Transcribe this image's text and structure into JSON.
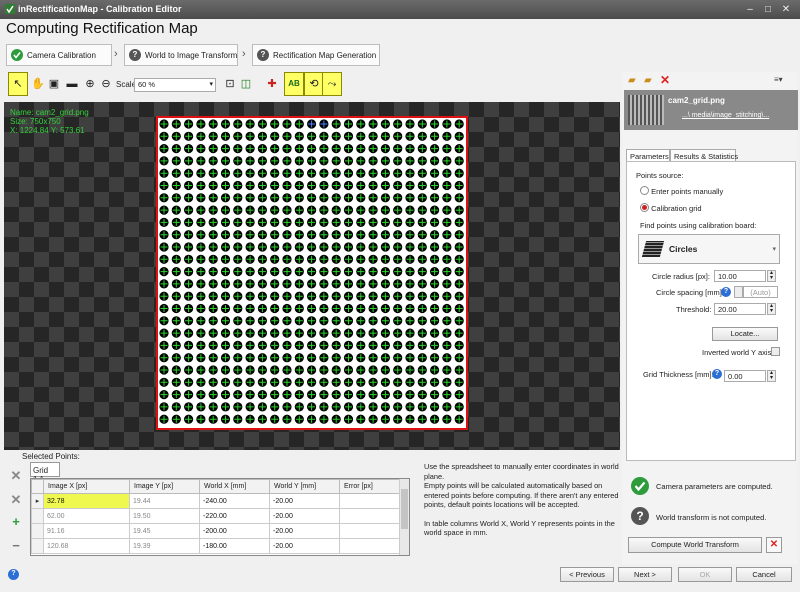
{
  "window": {
    "title": "inRectificationMap - Calibration Editor",
    "buttons": [
      "–",
      "□",
      "✕"
    ]
  },
  "page_title": "Computing Rectification Map",
  "steps": [
    {
      "label": "Camera Calibration",
      "status": "done"
    },
    {
      "label": "World to Image Transform",
      "status": "pending"
    },
    {
      "label": "Rectification Map Generation",
      "status": "pending"
    }
  ],
  "toolbar": {
    "scale_label": "Scale:",
    "scale_value": "60 %",
    "ab_label": "AB"
  },
  "image_info": {
    "name": "Name: cam2_grid.png",
    "size": "Size: 750x750",
    "coords": "X: 1224.84 Y: 573.61"
  },
  "selected_points": {
    "label": "Selected Points:",
    "grid_tab": "Grid 1.1",
    "columns": [
      "Image X [px]",
      "Image Y [px]",
      "World X [mm]",
      "World Y [mm]",
      "Error [px]"
    ],
    "rows": [
      [
        "32.78",
        "19.44",
        "-240.00",
        "-20.00",
        ""
      ],
      [
        "62.00",
        "19.50",
        "-220.00",
        "-20.00",
        ""
      ],
      [
        "91.16",
        "19.45",
        "-200.00",
        "-20.00",
        ""
      ],
      [
        "120.68",
        "19.39",
        "-180.00",
        "-20.00",
        ""
      ]
    ]
  },
  "description": {
    "p1": "Use the spreadsheet to manually enter coordinates in world plane.",
    "p2": "Empty points will be calculated automatically based on entered points before computing.  If there aren't any entered points, default points locations will be accepted.",
    "p3": "In table columns World X, World Y represents points in the world space in mm."
  },
  "file": {
    "name": "cam2_grid.png",
    "path": "...\\ media\\image_stitching\\..."
  },
  "panel_tabs": [
    "Parameters",
    "Results & Statistics"
  ],
  "parameters": {
    "points_source_label": "Points source:",
    "option_manual": "Enter points manually",
    "option_grid": "Calibration grid",
    "find_points_label": "Find points using calibration board:",
    "board_type": "Circles",
    "circle_radius_label": "Circle radius [px]:",
    "circle_radius": "10.00",
    "circle_spacing_label": "Circle spacing [mm]:",
    "circle_spacing": "(Auto)",
    "threshold_label": "Threshold:",
    "threshold": "20.00",
    "locate_button": "Locate...",
    "inverted_label": "Inverted world Y axis",
    "grid_thickness_label": "Grid Thickness [mm]:",
    "grid_thickness": "0.00"
  },
  "status": {
    "camera": "Camera parameters are computed.",
    "world": "World transform is not computed."
  },
  "compute_button": "Compute World Transform",
  "nav": {
    "previous": "< Previous",
    "next": "Next >",
    "ok": "OK",
    "cancel": "Cancel"
  }
}
